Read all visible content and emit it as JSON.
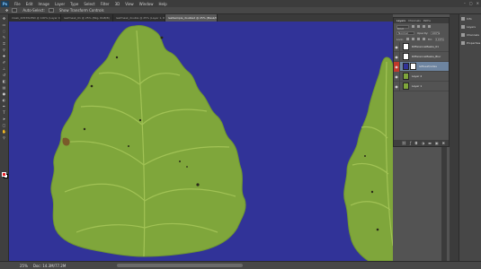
{
  "app": {
    "logo": "Ps",
    "menu": [
      "File",
      "Edit",
      "Image",
      "Layer",
      "Type",
      "Select",
      "Filter",
      "3D",
      "View",
      "Window",
      "Help"
    ],
    "window_controls": [
      "–",
      "▢",
      "✕"
    ]
  },
  "options_bar": {
    "items": [
      "Auto-Select:",
      "Show Transform Controls"
    ]
  },
  "tabs": [
    {
      "label": "mask_2053W.PSD @ 100% (Layer 0, RGB/8)",
      "active": false
    },
    {
      "label": "leafmask_01 @ 25% (Bkg, RGB/8)",
      "active": false
    },
    {
      "label": "leafmask_double @ 25% (Layer 1, RGB/8)",
      "active": false
    },
    {
      "label": "leafsample_doubled @ 25% (Mask/Double, RGB/8)",
      "active": true
    }
  ],
  "tools": [
    "move",
    "marquee",
    "lasso",
    "quick-select",
    "crop",
    "eyedropper",
    "heal",
    "brush",
    "stamp",
    "history",
    "eraser",
    "gradient",
    "blur",
    "dodge",
    "pen",
    "type",
    "path-select",
    "shape",
    "hand",
    "zoom"
  ],
  "colors": {
    "canvas_bg": "#313398",
    "leaf_fill": "#7fa63b",
    "leaf_edge": "#6f9630",
    "vein": "#a8c85a",
    "foreground": "#e21b23",
    "background": "#ffffff",
    "selected_layer": "#6d84a0"
  },
  "layers_panel": {
    "tabs": [
      "Layers",
      "Channels",
      "Paths"
    ],
    "kind": "Kind",
    "blend_mode": "Normal",
    "opacity_label": "Opacity:",
    "opacity_value": "100%",
    "lock_label": "Lock:",
    "fill_label": "Fill:",
    "fill_value": "100%",
    "layers": [
      {
        "name": "DifferenceMasks_01",
        "visible": true,
        "selected": false,
        "thumb": "#ffffff",
        "has_mask": false
      },
      {
        "name": "DifferenceMasks_Blur",
        "visible": true,
        "selected": false,
        "thumb": "#ffffff",
        "has_mask": false
      },
      {
        "name": "leftLeaf/sides",
        "visible": true,
        "selected": true,
        "thumb": "#313398",
        "has_mask": true
      },
      {
        "name": "Layer 2",
        "visible": true,
        "selected": false,
        "thumb": "#7fa63b",
        "has_mask": false
      },
      {
        "name": "Layer 1",
        "visible": true,
        "selected": false,
        "thumb": "#7fa63b",
        "has_mask": false
      }
    ],
    "bottom_icons": [
      "link-icon",
      "fx-icon",
      "mask-icon",
      "adjust-icon",
      "folder-icon",
      "new-layer-icon",
      "trash-icon"
    ]
  },
  "right_dock": [
    {
      "icon": "info-icon",
      "label": "Info"
    },
    {
      "icon": "layers-icon",
      "label": "Layers"
    },
    {
      "icon": "channels-icon",
      "label": "Channels"
    },
    {
      "icon": "properties-icon",
      "label": "Properties"
    }
  ],
  "status": {
    "zoom": "25%",
    "doc": "Doc: 14.3M/77.2M"
  }
}
